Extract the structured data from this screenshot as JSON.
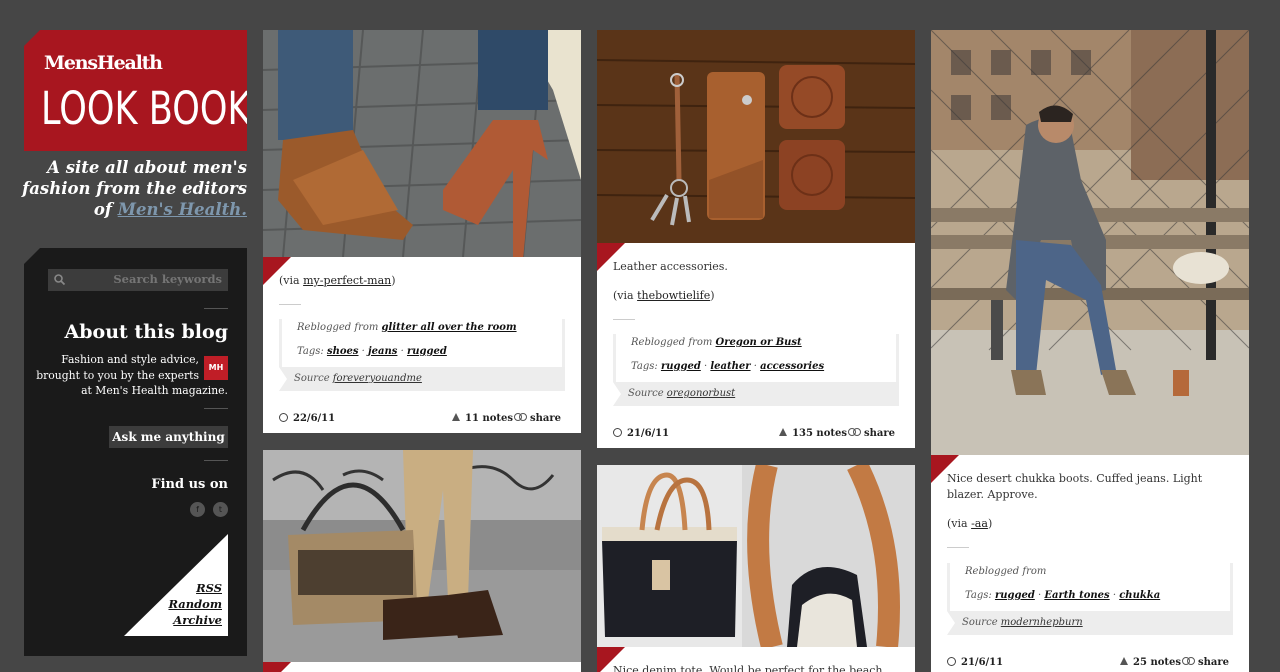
{
  "brand": {
    "logo_text": "MensHealth",
    "title": "LOOK BOOK"
  },
  "tagline": {
    "text": "A site all about men's fashion from the editors of ",
    "link": "Men's Health."
  },
  "sidebar": {
    "search_placeholder": "Search keywords",
    "about_title": "About this blog",
    "about_line1": "Fashion and style advice,",
    "about_line2": "brought to you by the experts",
    "about_line3": "at Men's Health magazine.",
    "badge": "MH",
    "ask_label": "Ask me anything",
    "find_us": "Find us on",
    "links": [
      "RSS",
      "Random",
      "Archive"
    ]
  },
  "posts": [
    {
      "caption_prefix": "(via ",
      "caption_link": "my-perfect-man",
      "caption_suffix": ")",
      "reblogged_prefix": "Reblogged from ",
      "reblogged_from": "glitter all over the room",
      "tags_label": "Tags: ",
      "tags": [
        "shoes",
        "jeans",
        "rugged"
      ],
      "source_label": "Source ",
      "source": "foreveryouandme",
      "date": "22/6/11",
      "notes": "11 notes",
      "share": "share"
    },
    {
      "text": "Leather accessories.",
      "caption_prefix": "(via ",
      "caption_link": "thebowtielife",
      "caption_suffix": ")",
      "reblogged_prefix": "Reblogged from ",
      "reblogged_from": "Oregon or Bust",
      "tags_label": "Tags: ",
      "tags": [
        "rugged",
        "leather",
        "accessories"
      ],
      "source_label": "Source ",
      "source": "oregonorbust",
      "date": "21/6/11",
      "notes": "135 notes",
      "share": "share"
    },
    {
      "text": "Nice desert chukka boots. Cuffed jeans. Light blazer. Approve.",
      "caption_prefix": "(via ",
      "caption_link": "-aa",
      "caption_suffix": ")",
      "reblogged_prefix": "Reblogged from",
      "reblogged_from": "",
      "tags_label": "Tags: ",
      "tags": [
        "rugged",
        "Earth tones",
        "chukka"
      ],
      "source_label": "Source ",
      "source": "modernhepburn",
      "date": "21/6/11",
      "notes": "25 notes",
      "share": "share"
    },
    {
      "text": ""
    },
    {
      "text": "Nice denim tote. Would be perfect for the beach."
    }
  ],
  "colors": {
    "background": "#464646",
    "brand_red": "#a8161f",
    "sidebar": "#1a1a1a"
  }
}
